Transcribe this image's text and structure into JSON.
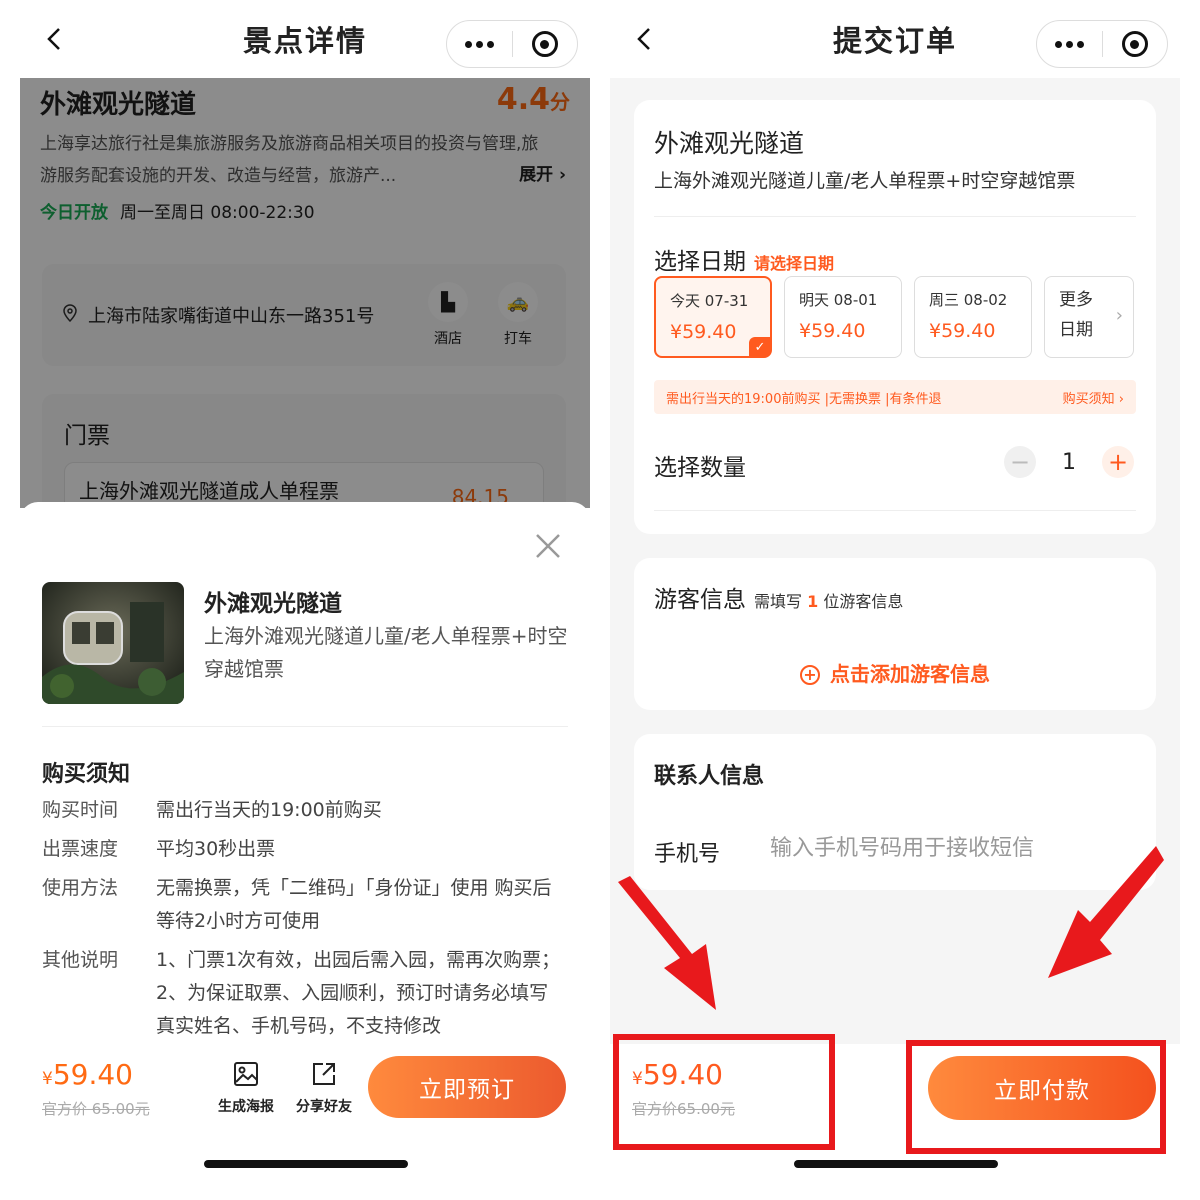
{
  "left": {
    "nav": {
      "title": "景点详情"
    },
    "attraction": {
      "name": "外滩观光隧道",
      "rating": "4.4",
      "rating_unit": "分",
      "description": "上海享达旅行社是集旅游服务及旅游商品相关项目的投资与管理,旅游服务配套设施的开发、改造与经营，旅游产...",
      "expand": "展开 ›",
      "open_status": "今日开放",
      "open_hours": "周一至周日 08:00-22:30",
      "address": "上海市陆家嘴街道中山东一路351号",
      "hotel_label": "酒店",
      "taxi_label": "打车",
      "tickets_title": "门票",
      "ticket_row_name": "上海外滩观光隧道成人单程票",
      "ticket_row_price": "84.15"
    },
    "sheet": {
      "product_name": "外滩观光隧道",
      "product_sub": "上海外滩观光隧道儿童/老人单程票+时空穿越馆票",
      "notice_title": "购买须知",
      "notices": [
        {
          "k": "购买时间",
          "v": "需出行当天的19:00前购买"
        },
        {
          "k": "出票速度",
          "v": "平均30秒出票"
        },
        {
          "k": "使用方法",
          "v": "无需换票，凭「二维码」「身份证」使用 购买后等待2小时方可使用"
        },
        {
          "k": "其他说明",
          "v": "1、门票1次有效，出园后需入园，需再次购票； 2、为保证取票、入园顺利，预订时请务必填写真实姓名、手机号码，不支持修改"
        }
      ],
      "price_symbol": "¥",
      "price": "59.40",
      "official_price": "官方价 65.00元",
      "poster_label": "生成海报",
      "share_label": "分享好友",
      "book_label": "立即预订"
    }
  },
  "right": {
    "nav": {
      "title": "提交订单"
    },
    "product": {
      "name": "外滩观光隧道",
      "sub": "上海外滩观光隧道儿童/老人单程票+时空穿越馆票"
    },
    "date": {
      "title": "选择日期",
      "hint": "请选择日期",
      "options": [
        {
          "label": "今天 07-31",
          "price": "¥59.40"
        },
        {
          "label": "明天 08-01",
          "price": "¥59.40"
        },
        {
          "label": "周三 08-02",
          "price": "¥59.40"
        }
      ],
      "more_line1": "更多",
      "more_line2": "日期",
      "tip": "需出行当天的19:00前购买 |无需换票 |有条件退",
      "tip_link": "购买须知 ›"
    },
    "quantity": {
      "label": "选择数量",
      "value": "1"
    },
    "traveler": {
      "title": "游客信息",
      "hint_pre": "需填写",
      "hint_num": "1",
      "hint_post": "位游客信息",
      "add": "点击添加游客信息"
    },
    "contact": {
      "title": "联系人信息",
      "phone_label": "手机号",
      "phone_placeholder": "输入手机号码用于接收短信"
    },
    "footer": {
      "price_symbol": "¥",
      "price": "59.40",
      "official_price": "官方价65.00元",
      "pay_label": "立即付款"
    }
  },
  "colors": {
    "accent": "#ff5a1f",
    "green": "#1aad57",
    "highlight": "#e8191c"
  }
}
